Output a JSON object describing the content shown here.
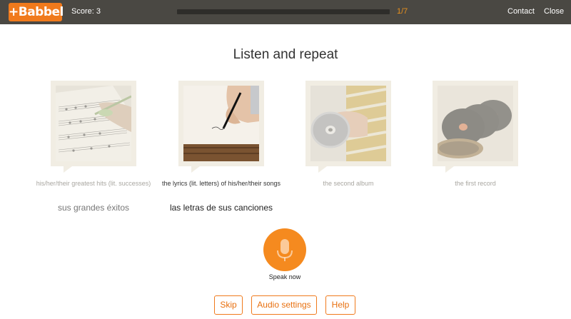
{
  "header": {
    "logo_text": "+Babbel",
    "score_label": "Score: 3",
    "progress_text": "1/7",
    "progress_fraction": 0.0,
    "contact_label": "Contact",
    "close_label": "Close"
  },
  "main": {
    "heading": "Listen and repeat",
    "cards": [
      {
        "english": "his/her/their greatest hits (lit. successes)",
        "spanish": "sus grandes éxitos",
        "image": "sheet-music-photo"
      },
      {
        "english": "the lyrics (lit. letters) of his/her/their songs",
        "spanish": "las letras de sus canciones",
        "image": "writing-hand-photo"
      },
      {
        "english": "the second album",
        "spanish": "",
        "image": "cd-in-hand-photo"
      },
      {
        "english": "the first record",
        "spanish": "",
        "image": "vinyl-records-photo"
      }
    ],
    "mic_icon": "microphone-icon",
    "speak_label": "Speak now"
  },
  "footer": {
    "skip_label": "Skip",
    "audio_settings_label": "Audio settings",
    "help_label": "Help"
  },
  "colors": {
    "brand_orange": "#f07a1c",
    "topbar": "#4a4843",
    "frame": "#f1ede3"
  }
}
